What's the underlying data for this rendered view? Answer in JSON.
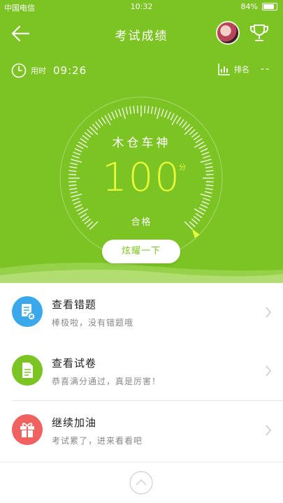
{
  "status_bar": {
    "carrier": "中国电信",
    "time": "10:32",
    "battery": "84%",
    "battery_level": 0.84
  },
  "header": {
    "title": "考试成绩",
    "icons": [
      "back-arrow-icon",
      "avatar",
      "trophy-icon"
    ]
  },
  "meta": {
    "time_label": "用时",
    "time_value": "09:26",
    "rank_label": "排名",
    "rank_value": "--"
  },
  "result": {
    "nickname": "木仓车神",
    "score": "100",
    "unit": "分",
    "status": "合格",
    "show_button": "炫耀一下"
  },
  "list": [
    {
      "title": "查看错题",
      "subtitle": "棒极啦，没有错题哦",
      "icon": "wrong-questions-icon",
      "color": "#3aa8ea"
    },
    {
      "title": "查看试卷",
      "subtitle": "恭喜满分通过，真是厉害！",
      "icon": "paper-icon",
      "color": "#7cc423"
    },
    {
      "title": "继续加油",
      "subtitle": "考试累了，进来看看吧",
      "icon": "gift-icon",
      "color": "#f0625f"
    }
  ],
  "colors": {
    "primary": "#7cc423",
    "score": "#e7fb3b"
  }
}
